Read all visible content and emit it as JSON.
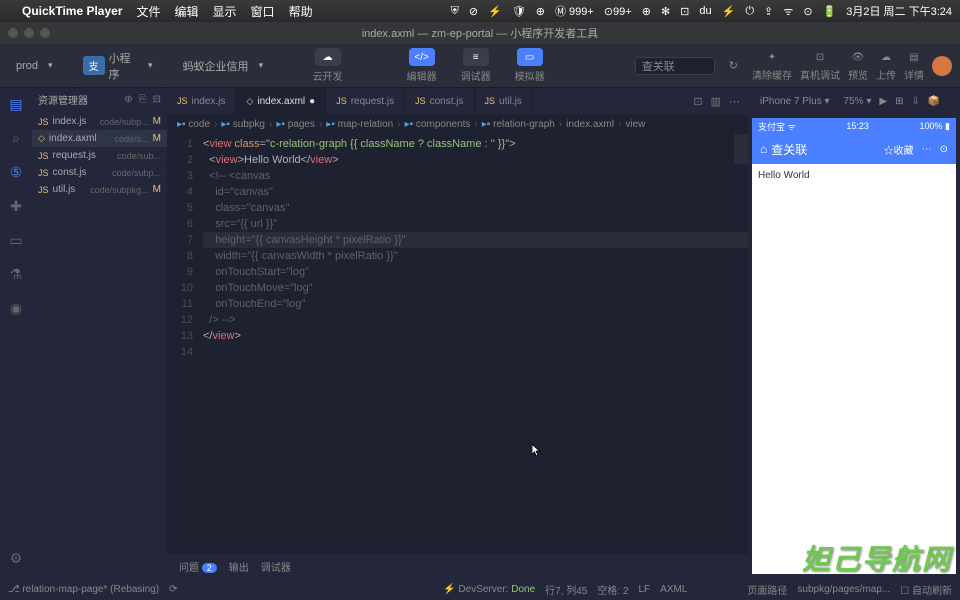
{
  "menubar": {
    "app": "QuickTime Player",
    "items": [
      "文件",
      "编辑",
      "显示",
      "窗口",
      "帮助"
    ],
    "right_icons": [
      "⛨",
      "⊘",
      "⚡",
      "🛡",
      "⊕",
      "Ⓜ 999+",
      "⊙99+",
      "⊕",
      "✻",
      "⊡",
      "du",
      "⚡",
      "⏻",
      "⇪",
      "ᯤ",
      "⊙",
      "🔋"
    ],
    "date": "3月2日 周二 下午3:24"
  },
  "window": {
    "title": "index.axml — zm-ep-portal — 小程序开发者工具"
  },
  "toolbar": {
    "env": "prod",
    "type_label": "小程序",
    "project": "蚂蚁企业信用",
    "cloud_label": "云开发",
    "mid": [
      {
        "icon": "</>",
        "label": "编辑器"
      },
      {
        "icon": "≡",
        "label": "调试器"
      },
      {
        "icon": "▭",
        "label": "模拟器"
      }
    ],
    "search": "查关联",
    "right": [
      "清除缓存",
      "真机调试",
      "预览",
      "上传",
      "详情"
    ]
  },
  "sidebar": {
    "title": "资源管理器",
    "files": [
      {
        "kind": "JS",
        "name": "index.js",
        "path": "code/subp...",
        "status": "M"
      },
      {
        "kind": "◇",
        "name": "index.axml",
        "path": "code/s...",
        "status": "M"
      },
      {
        "kind": "JS",
        "name": "request.js",
        "path": "code/sub..."
      },
      {
        "kind": "JS",
        "name": "const.js",
        "path": "code/subp..."
      },
      {
        "kind": "JS",
        "name": "util.js",
        "path": "code/subpkg...",
        "status": "M"
      }
    ]
  },
  "tabs": [
    {
      "kind": "JS",
      "name": "index.js"
    },
    {
      "kind": "◇",
      "name": "index.axml",
      "active": true,
      "dirty": true
    },
    {
      "kind": "JS",
      "name": "request.js"
    },
    {
      "kind": "JS",
      "name": "const.js"
    },
    {
      "kind": "JS",
      "name": "util.js"
    }
  ],
  "breadcrumb": [
    "code",
    "subpkg",
    "pages",
    "map-relation",
    "components",
    "relation-graph",
    "index.axml",
    "view"
  ],
  "code": {
    "lines": [
      [
        [
          "punc",
          "<"
        ],
        [
          "tag",
          "view"
        ],
        [
          "txt",
          " "
        ],
        [
          "attr",
          "class"
        ],
        [
          "punc",
          "="
        ],
        [
          "str",
          "\"c-relation-graph {{ className ? className : '' }}\""
        ],
        [
          "punc",
          ">"
        ]
      ],
      [
        [
          "txt",
          "  "
        ],
        [
          "punc",
          "<"
        ],
        [
          "tag",
          "view"
        ],
        [
          "punc",
          ">"
        ],
        [
          "txt",
          "Hello World"
        ],
        [
          "punc",
          "</"
        ],
        [
          "tag",
          "view"
        ],
        [
          "punc",
          ">"
        ]
      ],
      [
        [
          "txt",
          "  "
        ],
        [
          "cmt",
          "<!-- <canvas"
        ]
      ],
      [
        [
          "txt",
          "    "
        ],
        [
          "cmt",
          "id=\"canvas\""
        ]
      ],
      [
        [
          "txt",
          "    "
        ],
        [
          "cmt",
          "class=\"canvas\""
        ]
      ],
      [
        [
          "txt",
          "    "
        ],
        [
          "cmt",
          "src=\"{{ url }}\""
        ]
      ],
      [
        [
          "txt",
          "    "
        ],
        [
          "cmt",
          "height=\"{{ canvasHeight * pixelRatio }}\""
        ]
      ],
      [
        [
          "txt",
          "    "
        ],
        [
          "cmt",
          "width=\"{{ canvasWidth * pixelRatio }}\""
        ]
      ],
      [
        [
          "txt",
          "    "
        ],
        [
          "cmt",
          "onTouchStart=\"log\""
        ]
      ],
      [
        [
          "txt",
          "    "
        ],
        [
          "cmt",
          "onTouchMove=\"log\""
        ]
      ],
      [
        [
          "txt",
          "    "
        ],
        [
          "cmt",
          "onTouchEnd=\"log\""
        ]
      ],
      [
        [
          "txt",
          "  "
        ],
        [
          "cmt",
          "/> -->"
        ]
      ],
      [
        [
          "punc",
          "</"
        ],
        [
          "tag",
          "view"
        ],
        [
          "punc",
          ">"
        ]
      ],
      [
        [
          "txt",
          ""
        ]
      ]
    ],
    "highlight_row": 7
  },
  "bottom_tabs": {
    "problems": "问题",
    "problems_count": "2",
    "output": "输出",
    "debug": "调试器"
  },
  "simulator": {
    "device": "iPhone 7 Plus",
    "zoom": "75%",
    "status_left": "支付宝 ᯤ",
    "status_time": "15:23",
    "status_right": "100% ▮",
    "nav_title": "查关联",
    "nav_fav": "收藏",
    "content": "Hello World"
  },
  "statusbar": {
    "branch": "relation-map-page* (Rebasing)",
    "devserver_label": "DevServer:",
    "devserver_val": "Done",
    "pos": "行7, 列45",
    "spaces": "空格: 2",
    "eol": "LF",
    "lang": "AXML",
    "mode": "页面路径",
    "path": "subpkg/pages/map...",
    "refresh": "自动刷新"
  },
  "watermark": "妲己导航网"
}
